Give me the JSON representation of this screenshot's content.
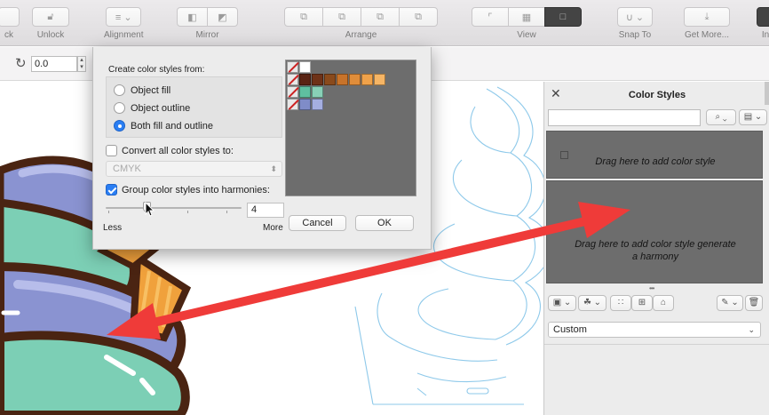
{
  "toolbar": {
    "items": [
      {
        "label": "ck"
      },
      {
        "label": "Unlock"
      },
      {
        "label": "Alignment"
      },
      {
        "label": "Mirror"
      },
      {
        "label": "Arrange"
      },
      {
        "label": "View"
      },
      {
        "label": "Snap To"
      },
      {
        "label": "Get More..."
      },
      {
        "label": "In"
      }
    ]
  },
  "property_bar": {
    "rotation_value": "0.0"
  },
  "dialog": {
    "title": "Create color styles from:",
    "options": [
      {
        "label": "Object fill",
        "selected": false
      },
      {
        "label": "Object outline",
        "selected": false
      },
      {
        "label": "Both fill and outline",
        "selected": true
      }
    ],
    "convert_label": "Convert all color styles to:",
    "convert_checked": false,
    "color_model": "CMYK",
    "group_label": "Group color styles into harmonies:",
    "group_checked": true,
    "slider_fraction": 0.3,
    "harmony_count": "4",
    "less_label": "Less",
    "more_label": "More",
    "cancel_label": "Cancel",
    "ok_label": "OK",
    "preview_rows": [
      [
        "none",
        "#ffffff"
      ],
      [
        "none",
        "#5a2414",
        "#6e3218",
        "#8a4a1c",
        "#c8732a",
        "#e08d3a",
        "#f0a24a",
        "#f6b565"
      ],
      [
        "none",
        "#5fbfa0",
        "#88d0b7"
      ],
      [
        "none",
        "#7f8cc8",
        "#a4aee0"
      ]
    ]
  },
  "docker": {
    "title": "Color Styles",
    "drop_single": "Drag here to add color style",
    "drop_harmony_line1": "Drag here to add color style  generate",
    "drop_harmony_line2": "a harmony",
    "palette_select": "Custom"
  },
  "colors": {
    "accent": "#2a7ef3",
    "annotation_arrow": "#ef3b39",
    "guide_lines": "#8ec9ea"
  }
}
